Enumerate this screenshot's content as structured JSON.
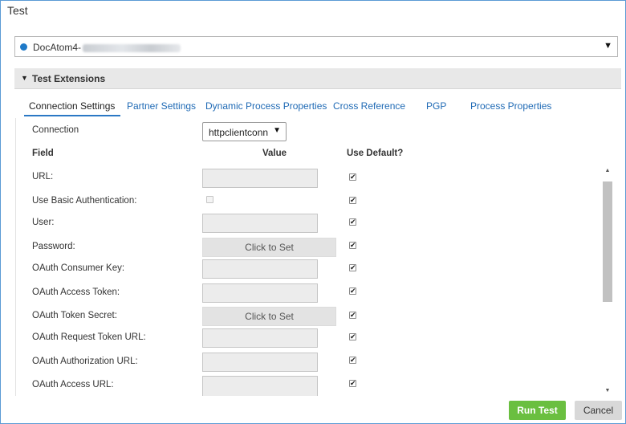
{
  "dialog": {
    "title": "Test"
  },
  "atom": {
    "name": "DocAtom4-",
    "status_color": "#1f7ac8",
    "caret": "▼"
  },
  "section": {
    "title": "Test Extensions",
    "toggle": "▼"
  },
  "tabs": [
    {
      "label": "Connection Settings",
      "active": true
    },
    {
      "label": "Partner Settings",
      "active": false
    },
    {
      "label": "Dynamic Process Properties",
      "active": false
    },
    {
      "label": "Cross Reference",
      "active": false
    },
    {
      "label": "PGP",
      "active": false
    },
    {
      "label": "Process Properties",
      "active": false
    }
  ],
  "connection": {
    "label": "Connection",
    "value": "httpclientconn",
    "caret": "▼"
  },
  "columns": {
    "field": "Field",
    "value": "Value",
    "use_default": "Use Default?"
  },
  "fields": [
    {
      "label": "URL:",
      "type": "text",
      "value": "",
      "use_default": true
    },
    {
      "label": "Use Basic Authentication:",
      "type": "checkbox",
      "checked": false,
      "use_default": true
    },
    {
      "label": "User:",
      "type": "text",
      "value": "",
      "use_default": true
    },
    {
      "label": "Password:",
      "type": "secret",
      "button": "Click to Set",
      "use_default": true
    },
    {
      "label": "OAuth Consumer Key:",
      "type": "text",
      "value": "",
      "use_default": true
    },
    {
      "label": "OAuth Access Token:",
      "type": "text",
      "value": "",
      "use_default": true
    },
    {
      "label": "OAuth Token Secret:",
      "type": "secret",
      "button": "Click to Set",
      "use_default": true
    },
    {
      "label": "OAuth Request Token URL:",
      "type": "text",
      "value": "",
      "use_default": true
    },
    {
      "label": "OAuth Authorization URL:",
      "type": "text",
      "value": "",
      "use_default": true
    },
    {
      "label": "OAuth Access URL:",
      "type": "text",
      "value": "",
      "use_default": true
    }
  ],
  "check_glyph": "✔",
  "buttons": {
    "run": "Run Test",
    "cancel": "Cancel"
  },
  "colors": {
    "accent": "#2b78c5",
    "run": "#6abf40",
    "link": "#1f6ab5"
  }
}
